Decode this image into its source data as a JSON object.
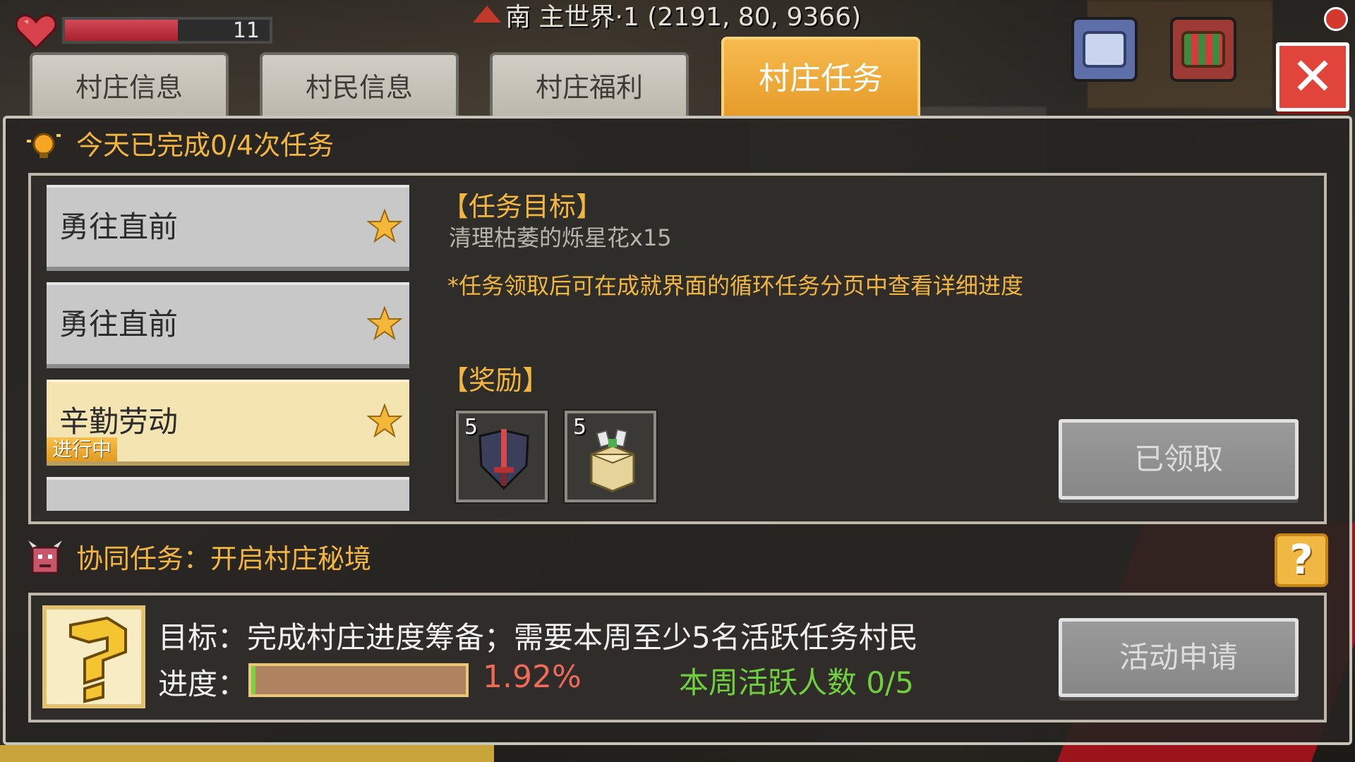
{
  "hud": {
    "hp_value": "11",
    "hp_fraction": 0.55,
    "location": "南  主世界·1 (2191, 80, 9366)"
  },
  "tabs": [
    {
      "label": "村庄信息",
      "active": false
    },
    {
      "label": "村民信息",
      "active": false
    },
    {
      "label": "村庄福利",
      "active": false
    },
    {
      "label": "村庄任务",
      "active": true
    }
  ],
  "daily": {
    "text": "今天已完成0/4次任务"
  },
  "tasks": [
    {
      "name": "勇往直前",
      "state": "normal"
    },
    {
      "name": "勇往直前",
      "state": "normal"
    },
    {
      "name": "辛勤劳动",
      "state": "current",
      "badge": "进行中"
    }
  ],
  "detail": {
    "goal_title": "【任务目标】",
    "goal_text": "清理枯萎的烁星花x15",
    "note": "*任务领取后可在成就界面的循环任务分页中查看详细进度",
    "reward_title": "【奖励】",
    "rewards": [
      {
        "count": "5",
        "icon": "sword-shield-icon"
      },
      {
        "count": "5",
        "icon": "treasure-box-icon"
      }
    ],
    "claim_label": "已领取"
  },
  "coop": {
    "title": "协同任务：开启村庄秘境",
    "goal": "目标：完成村庄进度筹备；需要本周至少5名活跃任务村民",
    "progress_label": "进度：",
    "progress_fraction": 0.0192,
    "progress_text": "1.92%",
    "active_text": "本周活跃人数 0/5",
    "apply_label": "活动申请",
    "help_label": "?"
  },
  "colors": {
    "accent_orange": "#f2b640",
    "active_tab": "#f0a93a",
    "close_red": "#e0443b",
    "pct_red": "#f06a5a",
    "active_green": "#6fcf3c"
  }
}
